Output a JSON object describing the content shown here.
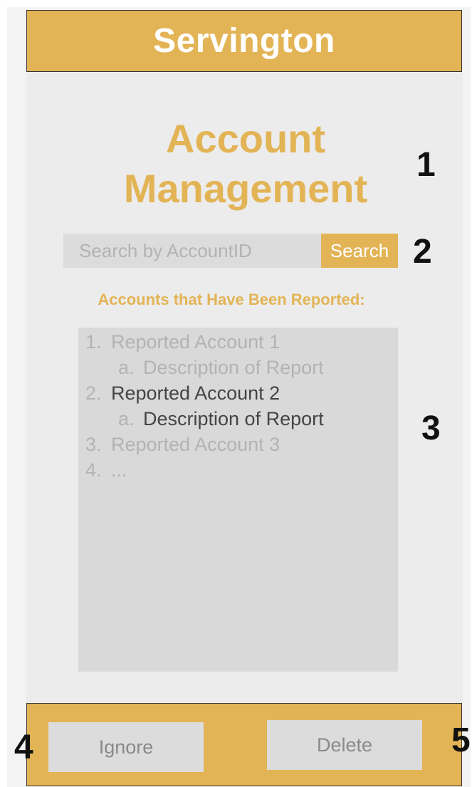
{
  "app": {
    "title": "Servington"
  },
  "page": {
    "title_line1": "Account",
    "title_line2": "Management"
  },
  "search": {
    "placeholder": "Search by AccountID",
    "button_label": "Search"
  },
  "reports": {
    "section_label": "Accounts that Have Been Reported:",
    "items": [
      {
        "number": "1.",
        "text": "Reported Account 1",
        "style": "muted",
        "level": 0
      },
      {
        "number": "a.",
        "text": "Description of Report",
        "style": "muted",
        "level": 1
      },
      {
        "number": "2.",
        "text": "Reported Account 2",
        "style": "dark",
        "level": 0
      },
      {
        "number": "a.",
        "text": "Description of Report",
        "style": "dark",
        "level": 1
      },
      {
        "number": "3.",
        "text": "Reported Account 3",
        "style": "muted",
        "level": 0
      },
      {
        "number": "4.",
        "text": "...",
        "style": "muted",
        "level": 0
      }
    ]
  },
  "footer": {
    "ignore_label": "Ignore",
    "delete_label": "Delete"
  },
  "annotations": {
    "a1": "1",
    "a2": "2",
    "a3": "3",
    "a4": "4",
    "a5": "5"
  },
  "colors": {
    "accent": "#e3b455",
    "screen_bg": "#ececec",
    "field_bg": "#dcdcdc",
    "list_bg": "#d9d9d9",
    "muted_text": "#b3b3b3",
    "dark_text": "#444444"
  }
}
